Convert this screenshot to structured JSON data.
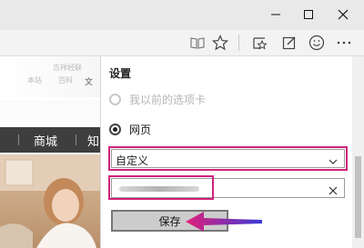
{
  "window": {
    "minimize_icon": "minimize-icon",
    "maximize_icon": "maximize-icon",
    "close_icon": "close-icon"
  },
  "toolbar": {
    "icons": [
      "reading-view-icon",
      "favorites-star-icon",
      "hub-icon",
      "web-note-icon",
      "feedback-smiley-icon",
      "more-icon"
    ]
  },
  "page": {
    "blur_texts": [
      "吉祥经联",
      "本站",
      "百科",
      "文"
    ],
    "nav_items": [
      "商城",
      "知"
    ]
  },
  "settings": {
    "title": "设置",
    "option_previous": "我以前的选项卡",
    "option_webpage": "网页",
    "select_value": "自定义",
    "save_label": "保存"
  },
  "colors": {
    "highlight": "#d0227a",
    "arrow": "#e0207a"
  }
}
